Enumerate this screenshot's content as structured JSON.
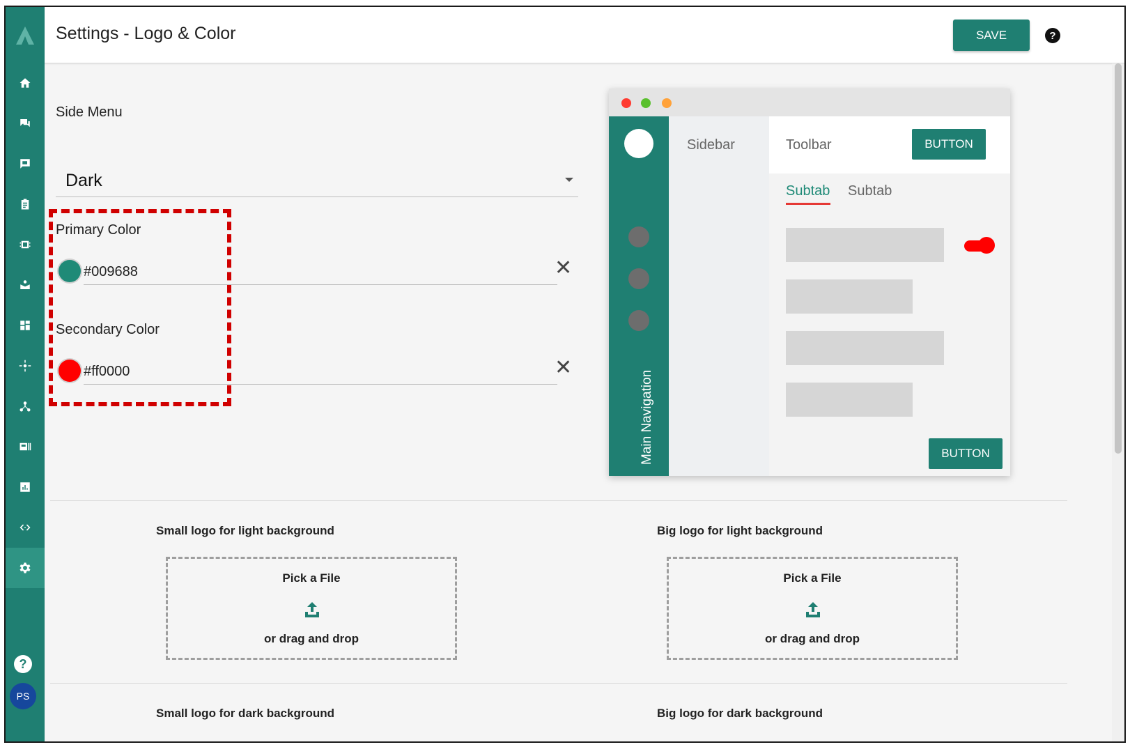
{
  "header": {
    "title": "Settings - Logo & Color",
    "save_label": "SAVE",
    "help_icon": "?"
  },
  "rail": {
    "items": [
      "home-icon",
      "chat-icon",
      "feedback-icon",
      "clipboard-icon",
      "chip-icon",
      "inbox-icon",
      "dashboard-icon",
      "sparkle-icon",
      "hub-icon",
      "id-card-icon",
      "chart-icon",
      "code-icon",
      "settings-icon"
    ],
    "active": "settings-icon",
    "help_label": "?",
    "avatar_initials": "PS"
  },
  "side_menu": {
    "label": "Side Menu",
    "value": "Dark"
  },
  "primary_color": {
    "label": "Primary Color",
    "value": "#009688",
    "swatch": "#1f8a77"
  },
  "secondary_color": {
    "label": "Secondary Color",
    "value": "#ff0000",
    "swatch": "#ff0000"
  },
  "preview": {
    "sidebar_label": "Sidebar",
    "toolbar_label": "Toolbar",
    "toolbar_button": "BUTTON",
    "tabs": [
      "Subtab",
      "Subtab"
    ],
    "nav_label": "Main Navigation",
    "bottom_button": "BUTTON",
    "window_dots": [
      "#ff3b30",
      "#5ac02e",
      "#ffa23a"
    ]
  },
  "uploads": [
    {
      "label": "Small logo for light background",
      "pick": "Pick a File",
      "or": "or drag and drop"
    },
    {
      "label": "Big logo for light background",
      "pick": "Pick a File",
      "or": "or drag and drop"
    },
    {
      "label": "Small logo for dark background"
    },
    {
      "label": "Big logo for dark background"
    }
  ],
  "colors": {
    "accent": "#1f7f72",
    "highlight": "#d00000"
  }
}
